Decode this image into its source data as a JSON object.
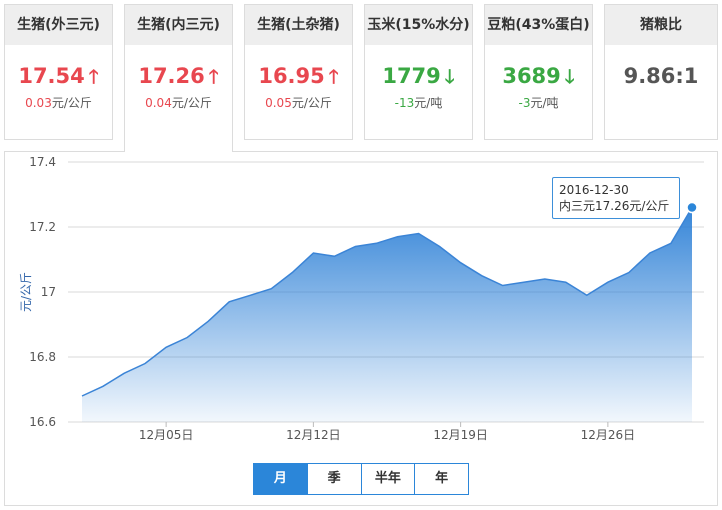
{
  "cards": [
    {
      "title": "生猪(外三元)",
      "price": "17.54",
      "trend": "up",
      "change": "0.03",
      "unit": "元/公斤"
    },
    {
      "title": "生猪(内三元)",
      "price": "17.26",
      "trend": "up",
      "change": "0.04",
      "unit": "元/公斤"
    },
    {
      "title": "生猪(土杂猪)",
      "price": "16.95",
      "trend": "up",
      "change": "0.05",
      "unit": "元/公斤"
    },
    {
      "title": "玉米(15%水分)",
      "price": "1779",
      "trend": "down",
      "change": "-13",
      "unit": "元/吨"
    },
    {
      "title": "豆粕(43%蛋白)",
      "price": "3689",
      "trend": "down",
      "change": "-3",
      "unit": "元/吨"
    },
    {
      "title": "猪粮比",
      "price": "9.86:1",
      "trend": "none",
      "change": "",
      "unit": ""
    }
  ],
  "arrows": {
    "up": "🡑",
    "down": "🡓"
  },
  "colors": {
    "up": "#e8474f",
    "down": "#3aa843",
    "accent": "#2b86d9"
  },
  "tabs": {
    "month": "月",
    "quarter": "季",
    "half_year": "半年",
    "year": "年"
  },
  "tooltip": {
    "date": "2016-12-30",
    "text": "内三元17.26元/公斤"
  },
  "chart_data": {
    "type": "area",
    "title": "",
    "xlabel": "",
    "ylabel": "元/公斤",
    "ylim": [
      16.6,
      17.4
    ],
    "yticks": [
      "17.4",
      "17.2",
      "17",
      "16.8",
      "16.6"
    ],
    "xticks": [
      "12月05日",
      "12月12日",
      "12月19日",
      "12月26日"
    ],
    "grid": true,
    "x": [
      "2016-12-01",
      "2016-12-02",
      "2016-12-03",
      "2016-12-04",
      "2016-12-05",
      "2016-12-06",
      "2016-12-07",
      "2016-12-08",
      "2016-12-09",
      "2016-12-10",
      "2016-12-11",
      "2016-12-12",
      "2016-12-13",
      "2016-12-14",
      "2016-12-15",
      "2016-12-16",
      "2016-12-17",
      "2016-12-18",
      "2016-12-19",
      "2016-12-20",
      "2016-12-21",
      "2016-12-22",
      "2016-12-23",
      "2016-12-24",
      "2016-12-25",
      "2016-12-26",
      "2016-12-27",
      "2016-12-28",
      "2016-12-29",
      "2016-12-30"
    ],
    "series": [
      {
        "name": "内三元",
        "values": [
          16.68,
          16.71,
          16.75,
          16.78,
          16.83,
          16.86,
          16.91,
          16.97,
          16.99,
          17.01,
          17.06,
          17.12,
          17.11,
          17.14,
          17.15,
          17.17,
          17.18,
          17.14,
          17.09,
          17.05,
          17.02,
          17.03,
          17.04,
          17.03,
          16.99,
          17.03,
          17.06,
          17.12,
          17.15,
          17.26
        ]
      }
    ]
  }
}
